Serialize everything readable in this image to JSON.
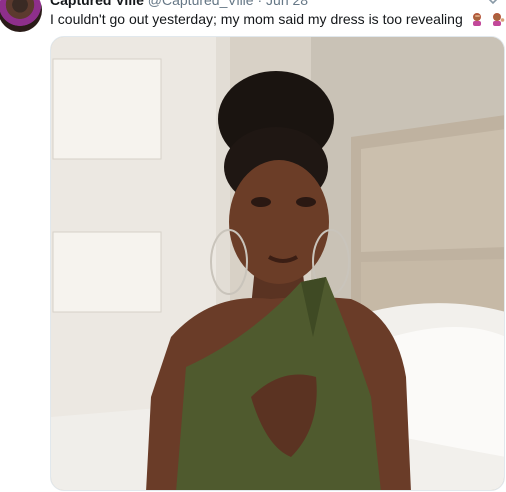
{
  "tweet": {
    "author_name": "Captured Ville",
    "author_handle": "@Captured_Ville",
    "separator": "·",
    "timestamp": "Jun 28",
    "text": "I couldn't go out yesterday; my mom said my dress is too revealing",
    "emojis": [
      "woman-facepalming-emoji",
      "woman-tipping-hand-emoji"
    ],
    "media_icon": "photo"
  },
  "colors": {
    "text_primary": "#14171a",
    "text_secondary": "#657786",
    "border": "#e1e8ed"
  }
}
